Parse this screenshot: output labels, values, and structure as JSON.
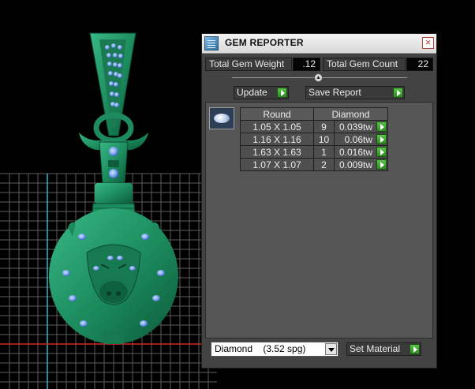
{
  "window": {
    "title": "GEM REPORTER",
    "close_icon": "close-icon",
    "app_icon": "report-window-icon"
  },
  "summary": {
    "total_gem_weight_label": "Total Gem Weight",
    "total_gem_weight_value": ".12",
    "total_gem_count_label": "Total Gem Count",
    "total_gem_count_value": "22"
  },
  "actions": {
    "update_label": "Update",
    "save_report_label": "Save Report"
  },
  "report": {
    "shape_icon": "round-diamond-icon",
    "header_shape": "Round",
    "header_material": "Diamond",
    "rows": [
      {
        "size": "1.05 X 1.05",
        "count": "9",
        "weight": "0.039tw"
      },
      {
        "size": "1.16 X 1.16",
        "count": "10",
        "weight": "0.06tw"
      },
      {
        "size": "1.63 X 1.63",
        "count": "1",
        "weight": "0.016tw"
      },
      {
        "size": "1.07 X 1.07",
        "count": "2",
        "weight": "0.009tw"
      }
    ]
  },
  "material": {
    "selected": "Diamond    (3.52 spg)",
    "set_material_label": "Set Material"
  },
  "colors": {
    "model_green": "#1e8a5e",
    "gem_blue": "#6f9ef0",
    "panel_bg": "#434343",
    "report_bg": "#565656",
    "accent_green": "#3ea82e"
  }
}
